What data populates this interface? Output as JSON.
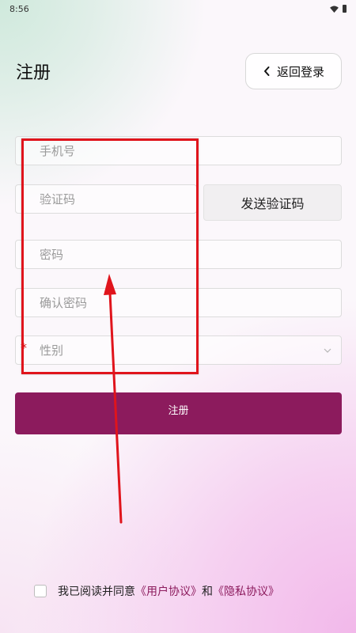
{
  "status_bar": {
    "time": "8:56"
  },
  "header": {
    "title": "注册",
    "back_label": "返回登录"
  },
  "form": {
    "phone_placeholder": "手机号",
    "code_placeholder": "验证码",
    "send_code_label": "发送验证码",
    "password_placeholder": "密码",
    "confirm_password_placeholder": "确认密码",
    "gender_placeholder": "性别",
    "required_mark": "*",
    "submit_label": "注册"
  },
  "agreement": {
    "prefix": "我已阅读并同意",
    "user_agreement": "《用户协议》",
    "conjunction": "和",
    "privacy_policy": "《隐私协议》"
  },
  "colors": {
    "accent": "#8c1b5d",
    "annotation": "#e0141c"
  }
}
